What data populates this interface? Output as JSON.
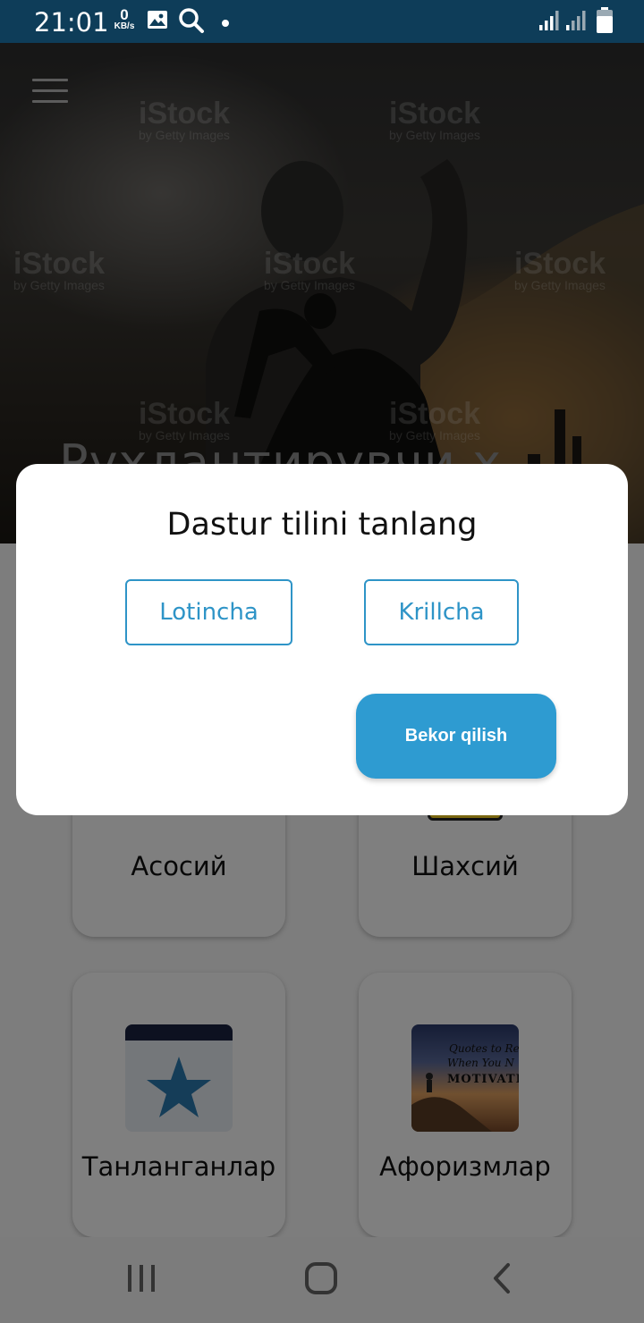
{
  "status_bar": {
    "time": "21:01",
    "speed_value": "0",
    "speed_unit": "KB/s",
    "icons": [
      "image-icon",
      "search-icon",
      "dot-icon",
      "signal-icon",
      "signal-icon-2",
      "battery-icon"
    ]
  },
  "header": {
    "menu_icon": "hamburger-menu-icon",
    "hero_title": "Руҳлантирувчи х",
    "watermark": "iStock",
    "watermark_sub": "by Getty Images"
  },
  "categories": [
    {
      "label": "Асосий",
      "icon": "main-icon"
    },
    {
      "label": "Шахсий",
      "icon": "personal-icon"
    },
    {
      "label": "Танланганлар",
      "icon": "star-icon"
    },
    {
      "label": "Афоризмлар",
      "icon": "motivation-image",
      "image_text": [
        "Quotes to Re",
        "When You N",
        "MOTIVATIO"
      ]
    }
  ],
  "dialog": {
    "title": "Dastur tilini tanlang",
    "latin_label": "Lotincha",
    "cyrillic_label": "Krillcha",
    "cancel_label": "Bekor qilish"
  },
  "nav_bar": {
    "icons": [
      "recent-apps-icon",
      "home-icon",
      "back-icon"
    ]
  },
  "colors": {
    "status_bar": "#0e3d59",
    "accent": "#2e94c7",
    "star": "#2a7ab0"
  }
}
